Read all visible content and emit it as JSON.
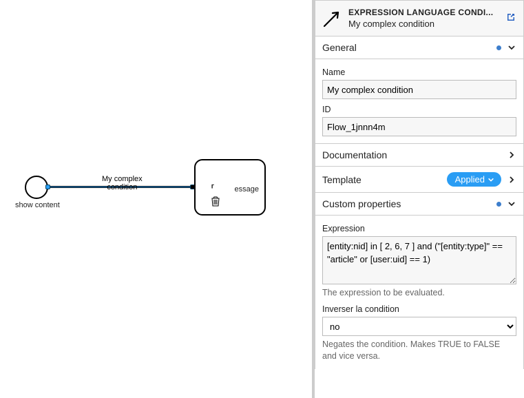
{
  "canvas": {
    "start_label": "show content",
    "flow_label_l1": "My complex",
    "flow_label_l2": "condition",
    "task_label": "essage"
  },
  "header": {
    "title": "EXPRESSION LANGUAGE CONDI...",
    "subtitle": "My complex condition"
  },
  "sections": {
    "general": {
      "title": "General",
      "name_label": "Name",
      "name_value": "My complex condition",
      "id_label": "ID",
      "id_value": "Flow_1jnnn4m"
    },
    "documentation": {
      "title": "Documentation"
    },
    "template": {
      "title": "Template",
      "badge": "Applied"
    },
    "custom": {
      "title": "Custom properties",
      "expression_label": "Expression",
      "expression_value": "[entity:nid] in [ 2, 6, 7 ] and (\"[entity:type]\" == \"article\" or [user:uid] == 1)",
      "expression_help": "The expression to be evaluated.",
      "negate_label": "Inverser la condition",
      "negate_value": "no",
      "negate_help": "Negates the condition. Makes TRUE to FALSE and vice versa."
    }
  }
}
